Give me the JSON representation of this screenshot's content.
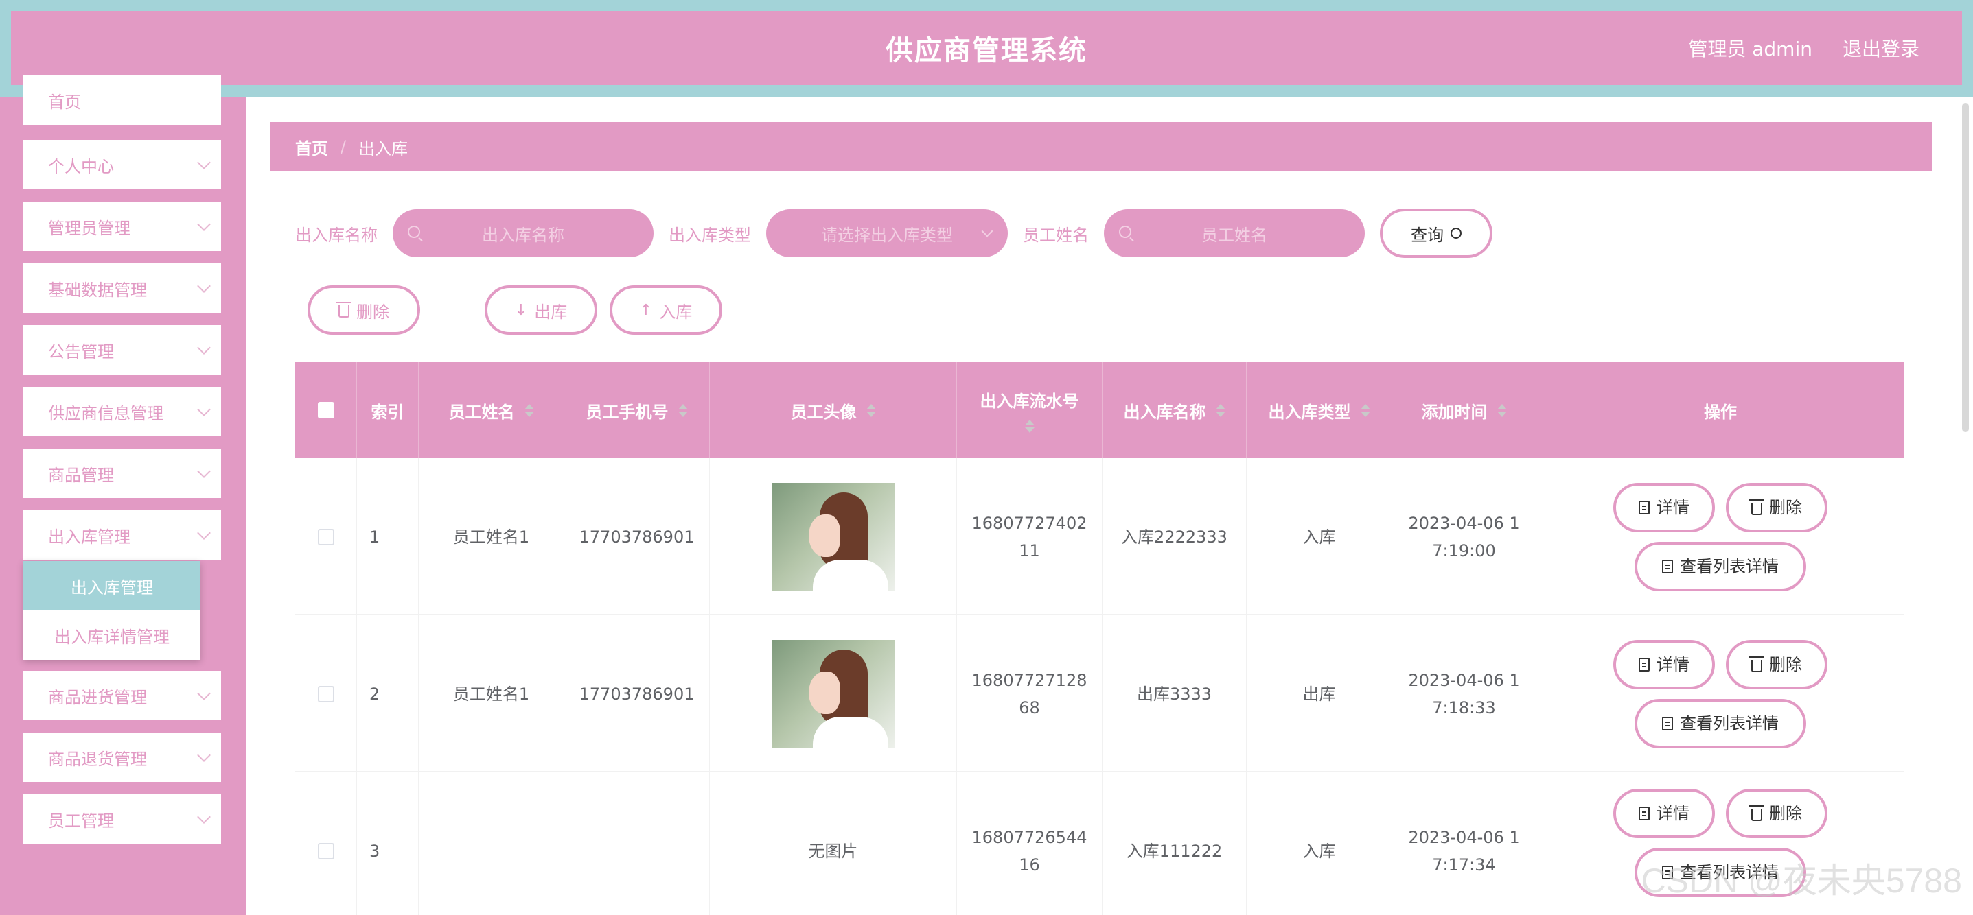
{
  "header": {
    "title": "供应商管理系统",
    "user": "管理员 admin",
    "logout": "退出登录"
  },
  "sidebar": {
    "items": [
      {
        "label": "首页"
      },
      {
        "label": "个人中心"
      },
      {
        "label": "管理员管理"
      },
      {
        "label": "基础数据管理"
      },
      {
        "label": "公告管理"
      },
      {
        "label": "供应商信息管理"
      },
      {
        "label": "商品管理"
      },
      {
        "label": "出入库管理"
      },
      {
        "label": "商品进货管理"
      },
      {
        "label": "商品退货管理"
      },
      {
        "label": "员工管理"
      }
    ],
    "submenu": [
      {
        "label": "出入库管理"
      },
      {
        "label": "出入库详情管理"
      }
    ]
  },
  "breadcrumb": {
    "home": "首页",
    "sep": "/",
    "current": "出入库"
  },
  "search": {
    "name_label": "出入库名称",
    "name_placeholder": "出入库名称",
    "type_label": "出入库类型",
    "type_placeholder": "请选择出入库类型",
    "staff_label": "员工姓名",
    "staff_placeholder": "员工姓名",
    "query": "查询"
  },
  "actions": {
    "delete": "删除",
    "out": "出库",
    "in": "入库"
  },
  "table": {
    "columns": [
      "索引",
      "员工姓名",
      "员工手机号",
      "员工头像",
      "出入库流水号",
      "出入库名称",
      "出入库类型",
      "添加时间",
      "操作"
    ],
    "rows": [
      {
        "index": "1",
        "name": "员工姓名1",
        "phone": "17703786901",
        "avatar": "",
        "serial": "1680772740211",
        "iname": "入库2222333",
        "type": "入库",
        "time": "2023-04-06 17:19:00"
      },
      {
        "index": "2",
        "name": "员工姓名1",
        "phone": "17703786901",
        "avatar": "",
        "serial": "1680772712868",
        "iname": "出库3333",
        "type": "出库",
        "time": "2023-04-06 17:18:33"
      },
      {
        "index": "3",
        "name": "",
        "phone": "",
        "avatar": "无图片",
        "serial": "1680772654416",
        "iname": "入库111222",
        "type": "入库",
        "time": "2023-04-06 17:17:34"
      }
    ],
    "ops": {
      "detail": "详情",
      "delete": "删除",
      "list_detail": "查看列表详情"
    }
  },
  "watermark": "CSDN @夜未央5788",
  "colors": {
    "primary": "#e29ac4",
    "accent": "#a3d3d8"
  }
}
